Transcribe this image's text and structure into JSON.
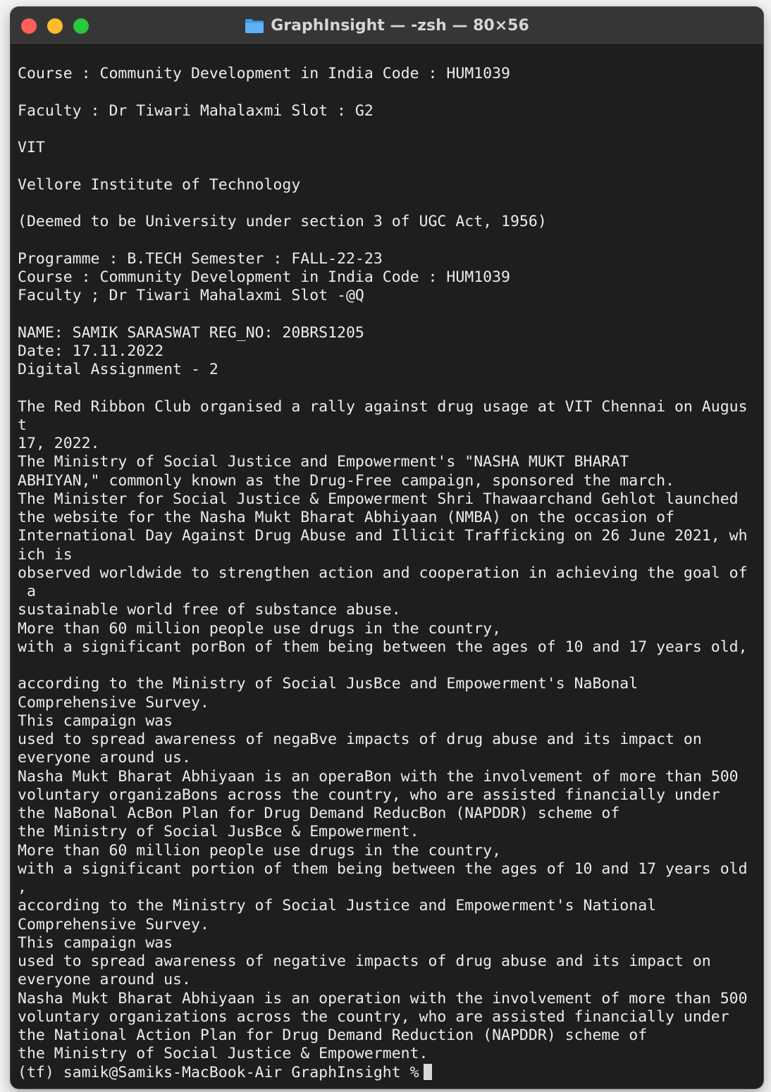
{
  "window": {
    "title": "GraphInsight — -zsh — 80×56",
    "folder_icon": "folder-icon",
    "traffic_lights": {
      "close_color": "#fe5f57",
      "minimize_color": "#febb2e",
      "maximize_color": "#28c840"
    }
  },
  "terminal": {
    "background": "#1e1e1e",
    "lines": [
      "Course : Community Development in India Code : HUM1039",
      "",
      "Faculty : Dr Tiwari Mahalaxmi Slot : G2",
      "",
      "VIT",
      "",
      "Vellore Institute of Technology",
      "",
      "(Deemed to be University under section 3 of UGC Act, 1956)",
      "",
      "Programme : B.TECH Semester : FALL-22-23",
      "Course : Community Development in India Code : HUM1039",
      "Faculty ; Dr Tiwari Mahalaxmi Slot -@Q",
      "",
      "NAME: SAMIK SARASWAT REG_NO: 20BRS1205",
      "Date: 17.11.2022",
      "Digital Assignment - 2",
      "",
      "The Red Ribbon Club organised a rally against drug usage at VIT Chennai on Augus",
      "t",
      "17, 2022.",
      "The Ministry of Social Justice and Empowerment's \"NASHA MUKT BHARAT",
      "ABHIYAN,\" commonly known as the Drug-Free campaign, sponsored the march.",
      "The Minister for Social Justice & Empowerment Shri Thawaarchand Gehlot launched",
      "the website for the Nasha Mukt Bharat Abhiyaan (NMBA) on the occasion of",
      "International Day Against Drug Abuse and Illicit Trafficking on 26 June 2021, wh",
      "ich is",
      "observed worldwide to strengthen action and cooperation in achieving the goal of",
      " a",
      "sustainable world free of substance abuse.",
      "More than 60 million people use drugs in the country,",
      "with a significant porBon of them being between the ages of 10 and 17 years old,",
      "",
      "according to the Ministry of Social JusBce and Empowerment's NaBonal",
      "Comprehensive Survey.",
      "This campaign was",
      "used to spread awareness of negaBve impacts of drug abuse and its impact on",
      "everyone around us.",
      "Nasha Mukt Bharat Abhiyaan is an operaBon with the involvement of more than 500",
      "voluntary organizaBons across the country, who are assisted financially under",
      "the NaBonal AcBon Plan for Drug Demand ReducBon (NAPDDR) scheme of",
      "the Ministry of Social JusBce & Empowerment.",
      "More than 60 million people use drugs in the country,",
      "with a significant portion of them being between the ages of 10 and 17 years old",
      ",",
      "according to the Ministry of Social Justice and Empowerment's National",
      "Comprehensive Survey.",
      "This campaign was",
      "used to spread awareness of negative impacts of drug abuse and its impact on",
      "everyone around us.",
      "Nasha Mukt Bharat Abhiyaan is an operation with the involvement of more than 500",
      "voluntary organizations across the country, who are assisted financially under",
      "the National Action Plan for Drug Demand Reduction (NAPDDR) scheme of",
      "the Ministry of Social Justice & Empowerment."
    ],
    "prompt": "(tf) samik@Samiks-MacBook-Air GraphInsight %"
  }
}
